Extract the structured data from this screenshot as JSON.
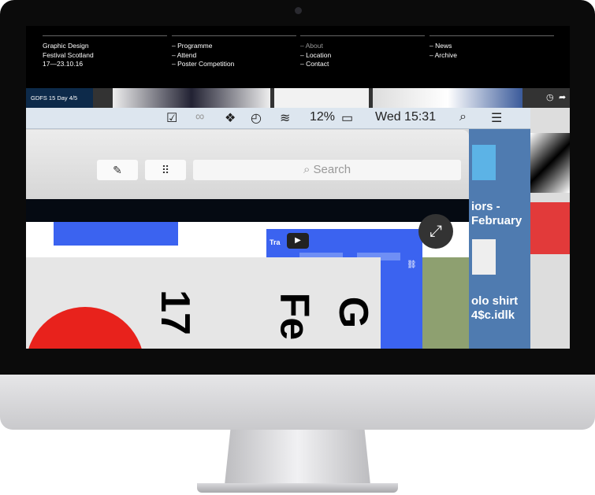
{
  "site": {
    "brand_lines": [
      "Graphic Design",
      "Festival Scotland",
      "17—23.10.16"
    ],
    "nav_col1": [
      "– Programme",
      "– Attend",
      "– Poster Competition"
    ],
    "nav_col2": [
      "– About",
      "– Location",
      "– Contact"
    ],
    "nav_col3": [
      "– News",
      "– Archive"
    ]
  },
  "video": {
    "title": "GDFS 15 Day 4/5",
    "menubar": {
      "battery": "12%",
      "clock": "Wed 15:31"
    },
    "search_placeholder": "Search",
    "panel_label": "Tra",
    "side_text": [
      "iors -",
      "February",
      "olo shirt",
      "4$c.idlk"
    ],
    "poster_chars": [
      "17",
      "Fe",
      "G"
    ]
  },
  "colors": {
    "accent_blue": "#3b63f0",
    "red": "#e8221c"
  }
}
